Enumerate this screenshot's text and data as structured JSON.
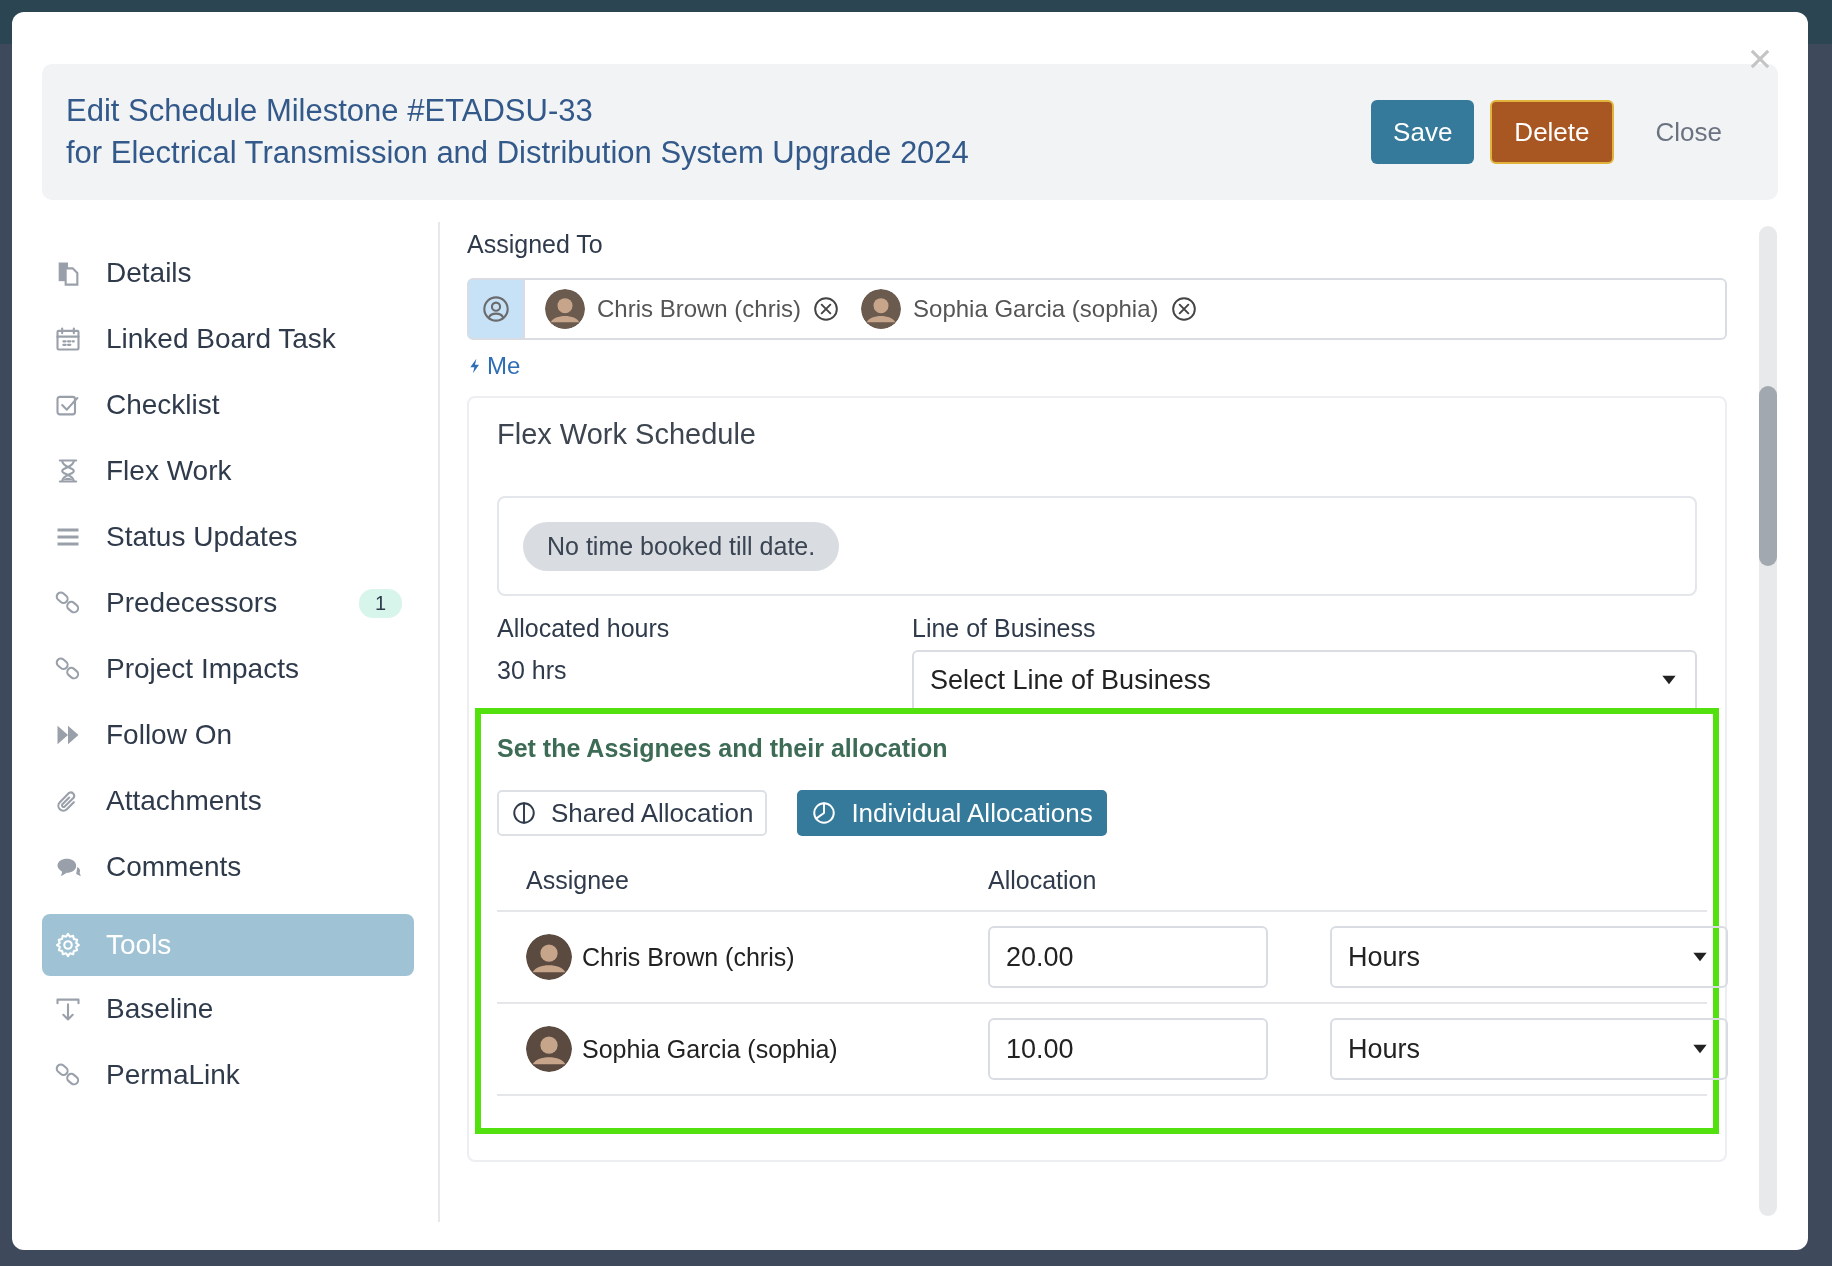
{
  "header": {
    "title": "Edit Schedule Milestone #ETADSU-33",
    "subtitle": "for Electrical Transmission and Distribution System Upgrade 2024"
  },
  "buttons": [
    {
      "label": "Save",
      "kind": "primary"
    },
    {
      "label": "Delete",
      "kind": "danger"
    },
    {
      "label": "Close",
      "kind": "link"
    }
  ],
  "sidebar": {
    "items": [
      {
        "label": "Details",
        "kind": "document",
        "selected": false
      },
      {
        "label": "Linked Board Task",
        "kind": "calendar",
        "selected": false
      },
      {
        "label": "Checklist",
        "kind": "checkbox",
        "selected": false
      },
      {
        "label": "Flex Work",
        "kind": "hourglass",
        "selected": false
      },
      {
        "label": "Status Updates",
        "kind": "lines",
        "selected": false
      },
      {
        "label": "Predecessors",
        "kind": "link",
        "selected": false,
        "badge": "1"
      },
      {
        "label": "Project Impacts",
        "kind": "link",
        "selected": false
      },
      {
        "label": "Follow On",
        "kind": "forward",
        "selected": false
      },
      {
        "label": "Attachments",
        "kind": "paperclip",
        "selected": false
      },
      {
        "label": "Comments",
        "kind": "chat",
        "selected": false
      },
      {
        "label": "Tools",
        "kind": "gear",
        "selected": true
      },
      {
        "label": "Baseline",
        "kind": "baseline",
        "selected": false
      },
      {
        "label": "PermaLink",
        "kind": "link",
        "selected": false
      }
    ]
  },
  "assigned_to": {
    "label": "Assigned To",
    "assignees": [
      {
        "name": "Chris Brown (chris)"
      },
      {
        "name": "Sophia Garcia (sophia)"
      }
    ],
    "me_link": "Me"
  },
  "flex_work": {
    "title": "Flex Work Schedule",
    "notice": "No time booked till date.",
    "allocated_hours": {
      "label": "Allocated hours",
      "value": "30 hrs"
    },
    "line_of_business": {
      "label": "Line of Business",
      "placeholder": "Select Line of Business"
    },
    "allocation": {
      "heading": "Set the Assignees and their allocation",
      "modes": [
        {
          "label": "Shared Allocation",
          "kind": "shared",
          "selected": false
        },
        {
          "label": "Individual Allocations",
          "kind": "individual",
          "selected": true
        }
      ],
      "columns": [
        "Assignee",
        "Allocation"
      ],
      "rows": [
        {
          "assignee": "Chris Brown (chris)",
          "value": "20.00",
          "unit": "Hours"
        },
        {
          "assignee": "Sophia Garcia (sophia)",
          "value": "10.00",
          "unit": "Hours"
        }
      ]
    }
  }
}
